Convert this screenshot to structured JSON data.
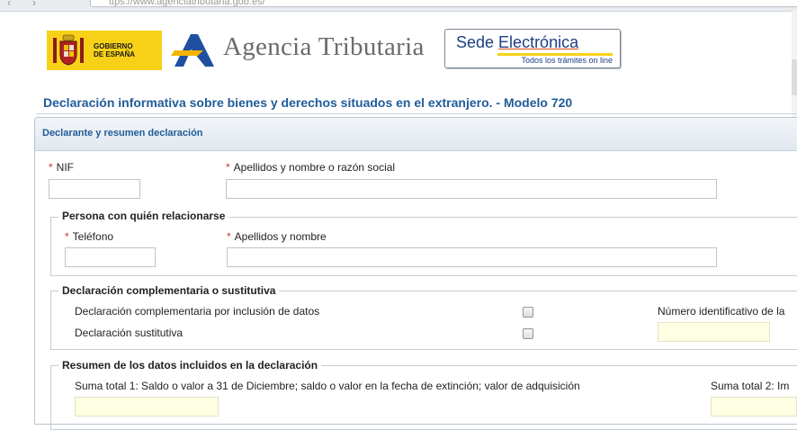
{
  "browser": {
    "back_glyph": "‹",
    "forward_glyph": "›",
    "url": "ttps://www.agenciatributaria.gob.es/"
  },
  "header": {
    "gobierno_line1": "GOBIERNO",
    "gobierno_line2": "DE ESPAÑA",
    "agency_name": "Agencia Tributaria",
    "sede_prefix": "Sede ",
    "sede_word": "Electrónica",
    "sede_tagline": "Todos los trámites on line",
    "colors": {
      "gob_yellow": "#f7d117",
      "sede_blue": "#1d3f86",
      "title_blue": "#1f5c99"
    }
  },
  "page_title": "Declaración informativa sobre bienes y derechos situados en el extranjero. - Modelo 720",
  "panel": {
    "title": "Declarante y resumen declaración",
    "required_mark": "*",
    "nif_label": "NIF",
    "nif_value": "",
    "nombre_label": "Apellidos y nombre o razón social",
    "nombre_value": "",
    "persona": {
      "legend": "Persona con quién relacionarse",
      "telefono_label": "Teléfono",
      "telefono_value": "",
      "nombre_label": "Apellidos y nombre",
      "nombre_value": ""
    },
    "complementaria": {
      "legend": "Declaración complementaria o sustitutiva",
      "option1": "Declaración complementaria por inclusión de datos",
      "option1_checked": false,
      "option2": "Declaración sustitutiva",
      "option2_checked": false,
      "numero_label": "Número identificativo de la",
      "numero_value": ""
    },
    "resumen": {
      "legend": "Resumen de los datos incluidos en la declaración",
      "suma1_label": "Suma total 1: Saldo o valor a 31 de Diciembre; saldo o valor en la fecha de extinción; valor de adquisición",
      "suma1_value": "",
      "suma2_label": "Suma total 2: Im",
      "suma2_value": ""
    }
  }
}
